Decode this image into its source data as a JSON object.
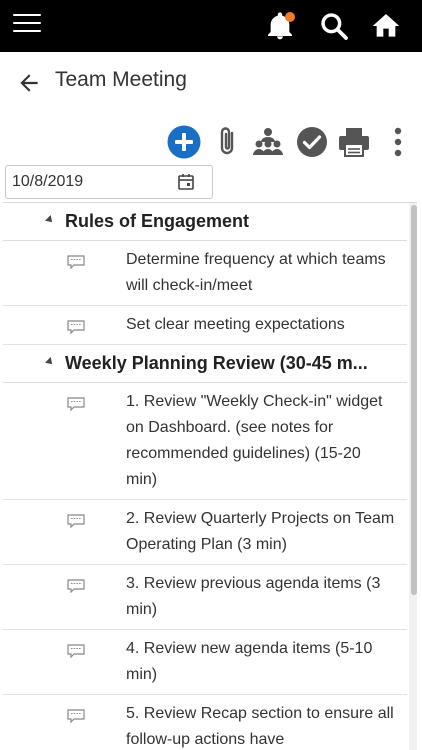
{
  "header": {
    "title": "Team Meeting"
  },
  "date_field": {
    "value": "10/8/2019"
  },
  "agenda": {
    "sections": [
      {
        "title": "Rules of Engagement",
        "items": [
          "Determine frequency at which teams will check-in/meet",
          "Set clear meeting expectations"
        ]
      },
      {
        "title": "Weekly Planning Review (30-45 m...",
        "items": [
          "1. Review \"Weekly Check-in\" widget on Dashboard. (see notes for recommended guidelines) (15-20 min)",
          "2. Review Quarterly Projects on Team Operating Plan (3 min)",
          "3. Review previous agenda items (3 min)",
          "4. Review new agenda items (5-10 min)",
          "5. Review Recap section to ensure all follow-up actions have"
        ]
      }
    ]
  },
  "colors": {
    "topbar": "#000000",
    "accent_blue": "#1a6fc4",
    "notification_dot": "#f47b2c",
    "icon_gray": "#555555"
  },
  "icons": [
    "menu-icon",
    "bell-icon",
    "search-icon",
    "home-icon",
    "back-arrow-icon",
    "add-icon",
    "paperclip-icon",
    "team-icon",
    "check-circle-icon",
    "printer-icon",
    "more-vertical-icon",
    "calendar-icon",
    "comment-icon",
    "caret-icon"
  ]
}
